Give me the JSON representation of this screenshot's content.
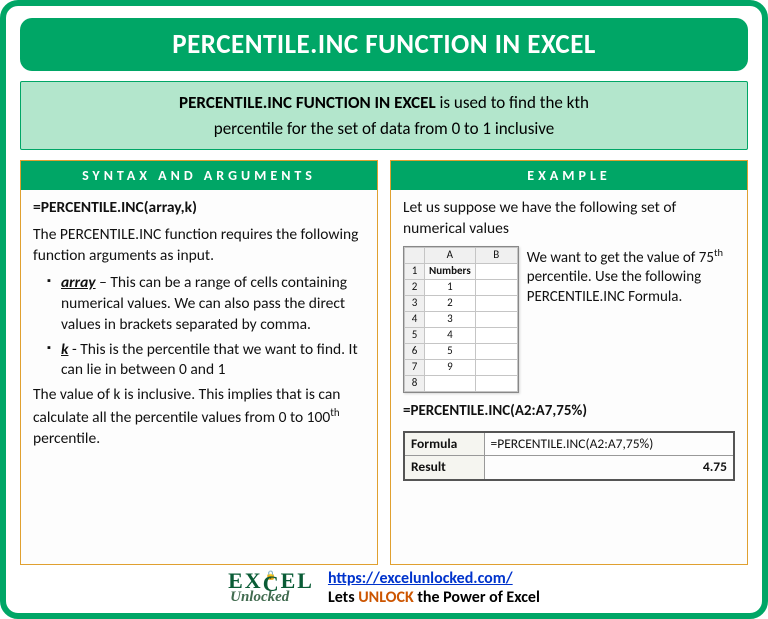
{
  "title": "PERCENTILE.INC FUNCTION IN EXCEL",
  "summary": {
    "bold": "PERCENTILE.INC FUNCTION IN EXCEL",
    "rest1": " is used to find the kth",
    "rest2": "percentile for the set of data from 0 to 1 inclusive"
  },
  "left": {
    "header": "SYNTAX AND ARGUMENTS",
    "formula": "=PERCENTILE.INC(array,k)",
    "intro": "The PERCENTILE.INC function requires the following function arguments as input.",
    "args": [
      {
        "name": "array",
        "sep": " – ",
        "desc": "This can be a range of cells containing numerical values. We can also pass the direct values in brackets separated by comma."
      },
      {
        "name": "k",
        "sep": " -  ",
        "desc": "This is the percentile that we want to find. It can lie in between 0 and 1"
      }
    ],
    "note_a": "The value of k is inclusive. This implies that is can calculate all the percentile values from 0 to 100",
    "note_b": " percentile."
  },
  "right": {
    "header": "EXAMPLE",
    "intro": "Let us suppose we have the following set of numerical values",
    "table": {
      "cols": [
        "A",
        "B"
      ],
      "header_cell": "Numbers",
      "rows": [
        "1",
        "2",
        "3",
        "4",
        "5",
        "9"
      ]
    },
    "desc_a": "We want to get the value of 75",
    "desc_b": " percentile. Use the following PERCENTILE.INC Formula.",
    "formula": "=PERCENTILE.INC(A2:A7,75%)",
    "result": {
      "formula_label": "Formula",
      "formula_val": "=PERCENTILE.INC(A2:A7,75%)",
      "result_label": "Result",
      "result_val": "4.75"
    }
  },
  "footer": {
    "logo1": "EX",
    "logo1b": "EL",
    "logo2": "Unlocked",
    "url": "https://excelunlocked.com/",
    "tag_a": "Lets ",
    "tag_b": "UNLOCK",
    "tag_c": " the Power of Excel"
  }
}
